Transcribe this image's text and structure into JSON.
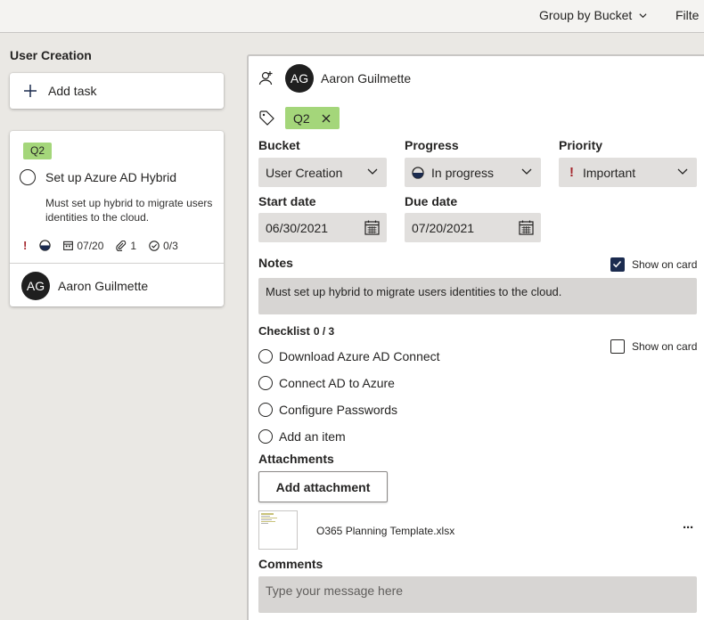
{
  "toolbar": {
    "group_by": "Group by Bucket",
    "filter": "Filte"
  },
  "bucket": {
    "name": "User Creation",
    "add_task": "Add task"
  },
  "task_card": {
    "label": "Q2",
    "title": "Set up Azure AD Hybrid",
    "notes": "Must set up hybrid to migrate users identities to the cloud.",
    "priority_icon": "!",
    "due": "07/20",
    "attachments_count": "1",
    "checklist_progress": "0/3",
    "assignee_initials": "AG",
    "assignee_name": "Aaron Guilmette"
  },
  "detail": {
    "assignee_initials": "AG",
    "assignee_name": "Aaron Guilmette",
    "label": "Q2",
    "bucket_label": "Bucket",
    "bucket_value": "User Creation",
    "progress_label": "Progress",
    "progress_value": "In progress",
    "priority_label": "Priority",
    "priority_value": "Important",
    "priority_icon": "!",
    "start_label": "Start date",
    "start_value": "06/30/2021",
    "due_label": "Due date",
    "due_value": "07/20/2021",
    "notes_label": "Notes",
    "notes_show_on_card": "Show on card",
    "notes_show_on_card_checked": true,
    "notes_value": "Must set up hybrid to migrate users identities to the cloud.",
    "checklist_label": "Checklist",
    "checklist_count": "0 / 3",
    "checklist_show_on_card": "Show on card",
    "checklist_show_on_card_checked": false,
    "checklist_items": [
      "Download Azure AD Connect",
      "Connect AD to Azure",
      "Configure Passwords"
    ],
    "add_item": "Add an item",
    "attachments_label": "Attachments",
    "add_attachment": "Add attachment",
    "attachment_name": "O365 Planning Template.xlsx",
    "more": "···",
    "comments_label": "Comments",
    "comment_placeholder": "Type your message here"
  },
  "colors": {
    "label_green": "#a4d67a",
    "important_red": "#a4262c",
    "checkbox_navy": "#1b2b4f",
    "field_gray": "#e1dfdd",
    "background": "#eae8e4"
  }
}
